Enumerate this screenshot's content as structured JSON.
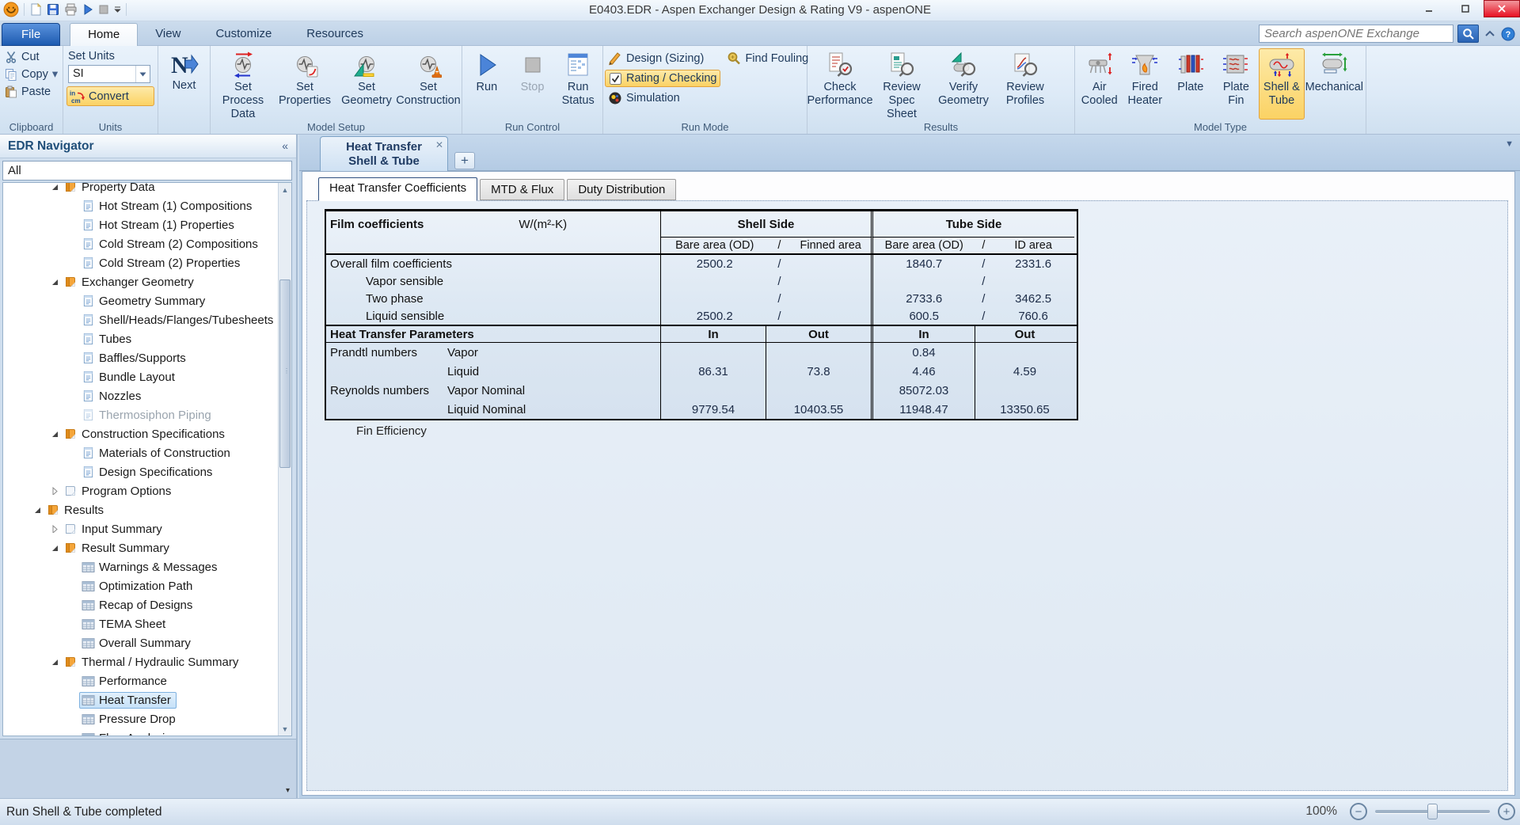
{
  "window": {
    "title": "E0403.EDR - Aspen Exchanger Design & Rating V9 - aspenONE",
    "quick_access": [
      "aspen-logo",
      "new-document",
      "save",
      "print",
      "run-small",
      "stop-small",
      "dropdown-arrow"
    ],
    "controls": [
      "minimize",
      "maximize",
      "close"
    ]
  },
  "menu_tabs": [
    {
      "label": "File",
      "style": "file"
    },
    {
      "label": "Home",
      "style": "active"
    },
    {
      "label": "View",
      "style": ""
    },
    {
      "label": "Customize",
      "style": ""
    },
    {
      "label": "Resources",
      "style": ""
    }
  ],
  "search": {
    "placeholder": "Search aspenONE Exchange"
  },
  "ribbon": {
    "groups": [
      {
        "id": "clipboard",
        "label": "Clipboard",
        "type": "clipboard",
        "items": [
          {
            "label": "Cut",
            "icon": "cut"
          },
          {
            "label": "Copy",
            "icon": "copy",
            "dropdown": true
          },
          {
            "label": "Paste",
            "icon": "paste"
          }
        ]
      },
      {
        "id": "units",
        "label": "Units",
        "type": "units",
        "set_units_label": "Set Units",
        "unit_value": "SI",
        "convert_label": "Convert",
        "convert_units": [
          "in",
          "cm"
        ]
      },
      {
        "id": "next",
        "label": "",
        "type": "big",
        "items": [
          {
            "lines": [
              "Next"
            ],
            "icon": "next"
          }
        ]
      },
      {
        "id": "model-setup",
        "label": "Model Setup",
        "type": "big",
        "items": [
          {
            "lines": [
              "Set Process",
              "Data"
            ],
            "icon": "set-process-data"
          },
          {
            "lines": [
              "Set",
              "Properties"
            ],
            "icon": "set-properties"
          },
          {
            "lines": [
              "Set",
              "Geometry"
            ],
            "icon": "set-geometry"
          },
          {
            "lines": [
              "Set",
              "Construction"
            ],
            "icon": "set-construction"
          }
        ]
      },
      {
        "id": "run-control",
        "label": "Run Control",
        "type": "big",
        "items": [
          {
            "lines": [
              "Run"
            ],
            "icon": "run"
          },
          {
            "lines": [
              "Stop"
            ],
            "icon": "stop",
            "disabled": true
          },
          {
            "lines": [
              "Run",
              "Status"
            ],
            "icon": "run-status"
          }
        ]
      },
      {
        "id": "run-mode",
        "label": "Run Mode",
        "type": "runmode",
        "items": [
          {
            "label": "Design (Sizing)",
            "icon": "design"
          },
          {
            "label": "Rating / Checking",
            "icon": "rating",
            "highlighted": true
          },
          {
            "label": "Simulation",
            "icon": "simulation"
          },
          {
            "label": "Find Fouling",
            "icon": "find-fouling",
            "col": 2
          }
        ]
      },
      {
        "id": "results",
        "label": "Results",
        "type": "big",
        "items": [
          {
            "lines": [
              "Check",
              "Performance"
            ],
            "icon": "check-performance"
          },
          {
            "lines": [
              "Review Spec",
              "Sheet"
            ],
            "icon": "review-spec-sheet"
          },
          {
            "lines": [
              "Verify",
              "Geometry"
            ],
            "icon": "verify-geometry"
          },
          {
            "lines": [
              "Review",
              "Profiles"
            ],
            "icon": "review-profiles"
          }
        ]
      },
      {
        "id": "model-type",
        "label": "Model Type",
        "type": "big",
        "items": [
          {
            "lines": [
              "Air",
              "Cooled"
            ],
            "icon": "air-cooled"
          },
          {
            "lines": [
              "Fired",
              "Heater"
            ],
            "icon": "fired-heater"
          },
          {
            "lines": [
              "Plate"
            ],
            "icon": "plate"
          },
          {
            "lines": [
              "Plate",
              "Fin"
            ],
            "icon": "plate-fin"
          },
          {
            "lines": [
              "Shell &",
              "Tube"
            ],
            "icon": "shell-tube",
            "highlighted": true
          },
          {
            "lines": [
              "Mechanical"
            ],
            "icon": "mechanical"
          }
        ]
      }
    ]
  },
  "navigator": {
    "title": "EDR Navigator",
    "collapse_glyph": "«",
    "filter_value": "All",
    "tree": [
      {
        "label": "Property Data",
        "level": 1,
        "icon": "folder",
        "arrow": "expanded",
        "cut": true
      },
      {
        "label": "Hot Stream (1) Compositions",
        "level": 2,
        "icon": "doc"
      },
      {
        "label": "Hot Stream (1) Properties",
        "level": 2,
        "icon": "doc"
      },
      {
        "label": "Cold Stream (2) Compositions",
        "level": 2,
        "icon": "doc"
      },
      {
        "label": "Cold Stream (2) Properties",
        "level": 2,
        "icon": "doc"
      },
      {
        "label": "Exchanger Geometry",
        "level": 1,
        "icon": "folder",
        "arrow": "expanded"
      },
      {
        "label": "Geometry Summary",
        "level": 2,
        "icon": "doc"
      },
      {
        "label": "Shell/Heads/Flanges/Tubesheets",
        "level": 2,
        "icon": "doc"
      },
      {
        "label": "Tubes",
        "level": 2,
        "icon": "doc"
      },
      {
        "label": "Baffles/Supports",
        "level": 2,
        "icon": "doc"
      },
      {
        "label": "Bundle Layout",
        "level": 2,
        "icon": "doc"
      },
      {
        "label": "Nozzles",
        "level": 2,
        "icon": "doc"
      },
      {
        "label": "Thermosiphon Piping",
        "level": 2,
        "icon": "doc",
        "disabled": true
      },
      {
        "label": "Construction Specifications",
        "level": 1,
        "icon": "folder",
        "arrow": "expanded"
      },
      {
        "label": "Materials of Construction",
        "level": 2,
        "icon": "doc"
      },
      {
        "label": "Design Specifications",
        "level": 2,
        "icon": "doc"
      },
      {
        "label": "Program Options",
        "level": 1,
        "icon": "folder-plain",
        "arrow": "collapsed"
      },
      {
        "label": "Results",
        "level": 0,
        "icon": "folder",
        "arrow": "expanded"
      },
      {
        "label": "Input Summary",
        "level": 1,
        "icon": "folder-plain",
        "arrow": "collapsed"
      },
      {
        "label": "Result Summary",
        "level": 1,
        "icon": "folder",
        "arrow": "expanded"
      },
      {
        "label": "Warnings & Messages",
        "level": 2,
        "icon": "grid"
      },
      {
        "label": "Optimization Path",
        "level": 2,
        "icon": "grid"
      },
      {
        "label": "Recap of Designs",
        "level": 2,
        "icon": "grid"
      },
      {
        "label": "TEMA Sheet",
        "level": 2,
        "icon": "grid"
      },
      {
        "label": "Overall Summary",
        "level": 2,
        "icon": "grid"
      },
      {
        "label": "Thermal / Hydraulic Summary",
        "level": 1,
        "icon": "folder",
        "arrow": "expanded"
      },
      {
        "label": "Performance",
        "level": 2,
        "icon": "grid"
      },
      {
        "label": "Heat Transfer",
        "level": 2,
        "icon": "grid",
        "selected": true
      },
      {
        "label": "Pressure Drop",
        "level": 2,
        "icon": "grid"
      },
      {
        "label": "Flow Analysis",
        "level": 2,
        "icon": "grid"
      }
    ]
  },
  "main": {
    "doc_tab": {
      "lines": [
        "Heat Transfer",
        "Shell & Tube"
      ],
      "close_glyph": "✕"
    },
    "new_tab_glyph": "+",
    "content_tabs": [
      {
        "label": "Heat Transfer Coefficients",
        "active": true
      },
      {
        "label": "MTD & Flux",
        "active": false
      },
      {
        "label": "Duty Distribution",
        "active": false
      }
    ],
    "fin_label": "Fin Efficiency"
  },
  "film_table": {
    "title": "Film coefficients",
    "units": "W/(m²-K)",
    "shell_header": "Shell Side",
    "tube_header": "Tube Side",
    "shell_sub": {
      "left": "Bare area (OD)",
      "slash": "/",
      "right": "Finned area"
    },
    "tube_sub": {
      "left": "Bare area (OD)",
      "slash": "/",
      "right": "ID area"
    },
    "rows": [
      {
        "label": "Overall film coefficients",
        "indent": false,
        "shell": [
          "2500.2",
          "/",
          ""
        ],
        "tube": [
          "1840.7",
          "/",
          "2331.6"
        ]
      },
      {
        "label": "Vapor sensible",
        "indent": true,
        "shell": [
          "",
          "/",
          ""
        ],
        "tube": [
          "",
          "/",
          ""
        ]
      },
      {
        "label": "Two phase",
        "indent": true,
        "shell": [
          "",
          "/",
          ""
        ],
        "tube": [
          "2733.6",
          "/",
          "3462.5"
        ]
      },
      {
        "label": "Liquid sensible",
        "indent": true,
        "shell": [
          "2500.2",
          "/",
          ""
        ],
        "tube": [
          "600.5",
          "/",
          "760.6"
        ]
      }
    ]
  },
  "params_table": {
    "title": "Heat Transfer Parameters",
    "col_headers": [
      "In",
      "Out",
      "In",
      "Out"
    ],
    "rows": [
      {
        "group": "Prandtl numbers",
        "label": "Vapor",
        "values": [
          "",
          "",
          "0.84",
          ""
        ]
      },
      {
        "group": "",
        "label": "Liquid",
        "values": [
          "86.31",
          "73.8",
          "4.46",
          "4.59"
        ]
      },
      {
        "group": "Reynolds numbers",
        "label": "Vapor Nominal",
        "values": [
          "",
          "",
          "85072.03",
          ""
        ]
      },
      {
        "group": "",
        "label": "Liquid Nominal",
        "values": [
          "9779.54",
          "10403.55",
          "11948.47",
          "13350.65"
        ]
      }
    ]
  },
  "status_bar": {
    "message": "Run Shell & Tube completed",
    "zoom_label": "100%"
  }
}
